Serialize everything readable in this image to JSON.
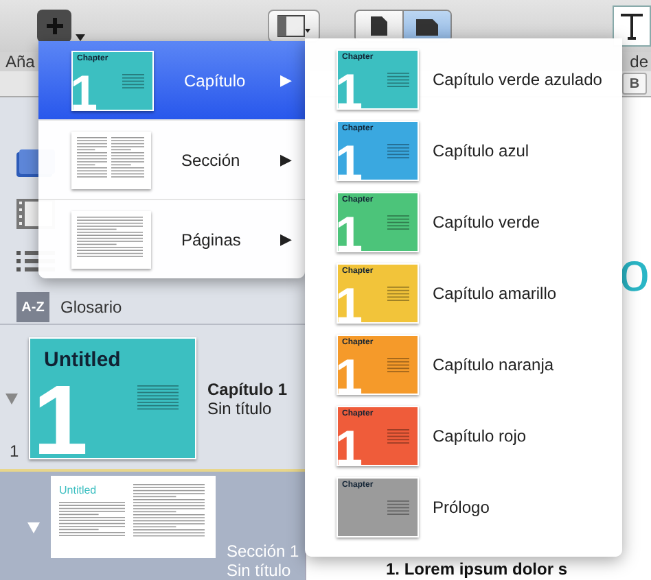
{
  "toolbar": {
    "add_label": "Aña",
    "right_label": "de",
    "bold_button": "B",
    "page_view": [
      {
        "selected": false
      },
      {
        "selected": true
      }
    ]
  },
  "sidebar": {
    "glossary": {
      "badge": "A-Z",
      "label": "Glosario"
    },
    "entries": [
      {
        "kind": "chapter",
        "title": "Capítulo 1",
        "subtitle": "Sin título",
        "page_number": "1",
        "thumb_title": "Untitled",
        "thumb_number": "1",
        "selected": false,
        "expanded": true
      },
      {
        "kind": "section",
        "title": "Sección 1",
        "subtitle": "Sin título",
        "thumb_title": "Untitled",
        "selected": true,
        "expanded": true
      }
    ]
  },
  "document": {
    "title_fragment": "o",
    "list_item": "1. Lorem ipsum dolor s"
  },
  "insert_menu": {
    "items": [
      {
        "kind": "chapter",
        "label": "Capítulo",
        "arrow": "▶",
        "thumb_label": "Chapter",
        "thumb_number": "1",
        "selected": true
      },
      {
        "kind": "section",
        "label": "Sección",
        "arrow": "▶",
        "selected": false
      },
      {
        "kind": "pages",
        "label": "Páginas",
        "arrow": "▶",
        "selected": false
      }
    ]
  },
  "submenu": {
    "items": [
      {
        "label": "Capítulo verde azulado",
        "thumb_label": "Chapter",
        "thumb_number": "1",
        "color": "#3cbfc1"
      },
      {
        "label": "Capítulo azul",
        "thumb_label": "Chapter",
        "thumb_number": "1",
        "color": "#3aa8e0"
      },
      {
        "label": "Capítulo verde",
        "thumb_label": "Chapter",
        "thumb_number": "1",
        "color": "#4cc47a"
      },
      {
        "label": "Capítulo amarillo",
        "thumb_label": "Chapter",
        "thumb_number": "1",
        "color": "#f2c43a"
      },
      {
        "label": "Capítulo naranja",
        "thumb_label": "Chapter",
        "thumb_number": "1",
        "color": "#f59a2a"
      },
      {
        "label": "Capítulo rojo",
        "thumb_label": "Chapter",
        "thumb_number": "1",
        "color": "#ef5c3a"
      },
      {
        "label": "Prólogo",
        "thumb_label": "Chapter",
        "color": "#9b9b9b"
      }
    ]
  }
}
